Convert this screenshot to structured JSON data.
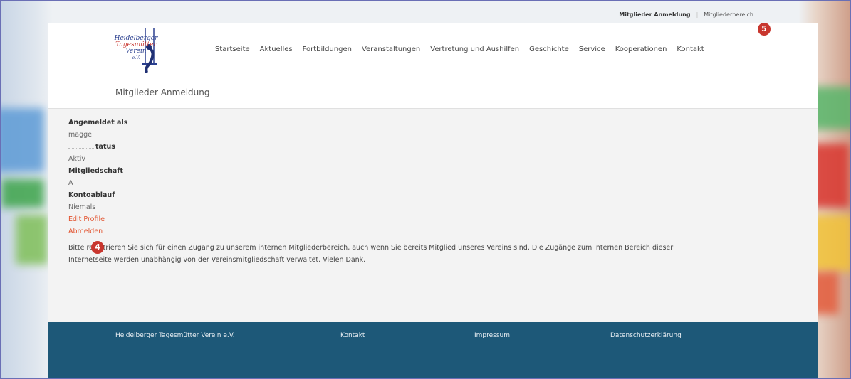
{
  "top_links": {
    "login": "Mitglieder Anmeldung",
    "members_area": "Mitgliederbereich"
  },
  "logo": {
    "line1": "Heidelberger",
    "line2": "Tagesmütter",
    "line3": "Verein",
    "line4": "e.V."
  },
  "nav": {
    "items": [
      "Startseite",
      "Aktuelles",
      "Fortbildungen",
      "Veranstaltungen",
      "Vertretung und Aushilfen",
      "Geschichte",
      "Service",
      "Kooperationen",
      "Kontakt"
    ]
  },
  "page_title": "Mitglieder Anmeldung",
  "account": {
    "logged_in_label": "Angemeldet als",
    "username": "magge",
    "status_label": "tatus",
    "status_value": "Aktiv",
    "membership_label": "Mitgliedschaft",
    "membership_value": "A",
    "expiry_label": "Kontoablauf",
    "expiry_value": "Niemals",
    "edit_profile": "Edit Profile",
    "logout": "Abmelden"
  },
  "notice": "Bitte registrieren Sie sich für einen Zugang zu unserem internen Mitgliederbereich, auch wenn Sie bereits Mitglied unseres Vereins sind. Die Zugänge zum internen Bereich dieser Internetseite werden unabhängig von der Vereinsmitgliedschaft verwaltet. Vielen Dank.",
  "markers": {
    "five": "5",
    "four": "4"
  },
  "footer": {
    "name": "Heidelberger Tagesmütter Verein e.V.",
    "contact": "Kontakt",
    "imprint": "Impressum",
    "privacy": "Datenschutzerklärung"
  },
  "colors": {
    "accent": "#e2532f",
    "footer_bg": "#1d5878",
    "marker": "#c8362e"
  }
}
